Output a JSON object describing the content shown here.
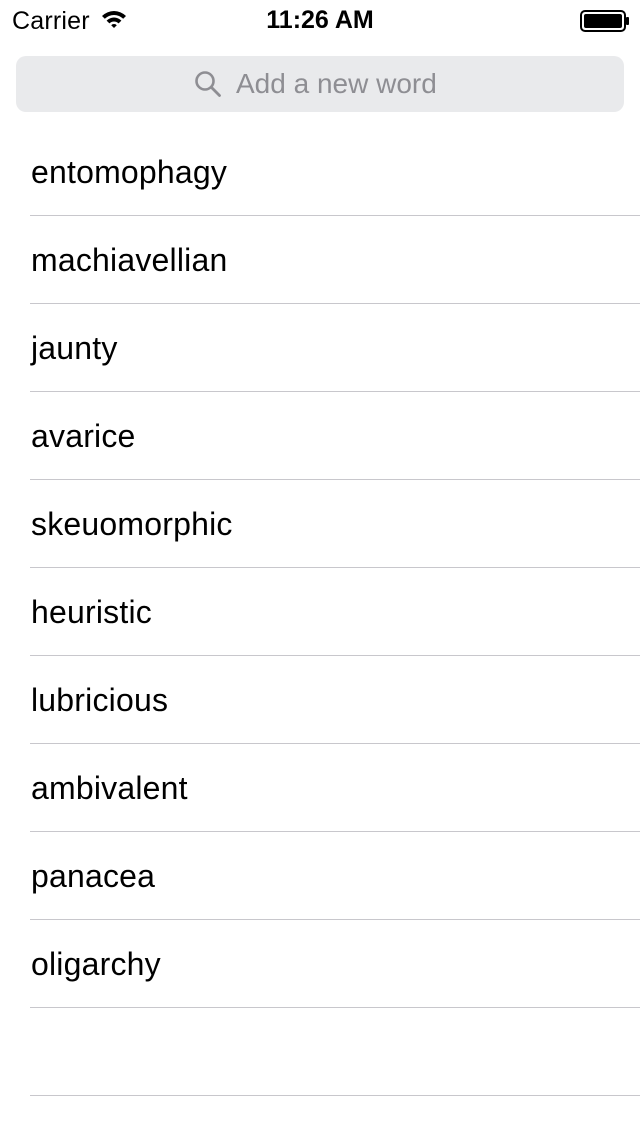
{
  "status_bar": {
    "carrier": "Carrier",
    "time": "11:26 AM",
    "icons": [
      "wifi-icon",
      "battery-icon"
    ]
  },
  "search": {
    "placeholder": "Add a new word",
    "value": "",
    "icon": "search-icon"
  },
  "words": [
    "entomophagy",
    "machiavellian",
    "jaunty",
    "avarice",
    "skeuomorphic",
    "heuristic",
    "lubricious",
    "ambivalent",
    "panacea",
    "oligarchy",
    ""
  ],
  "colors": {
    "search_background": "#e9eaec",
    "placeholder": "#8e8e93",
    "separator": "#c8c7cc"
  }
}
